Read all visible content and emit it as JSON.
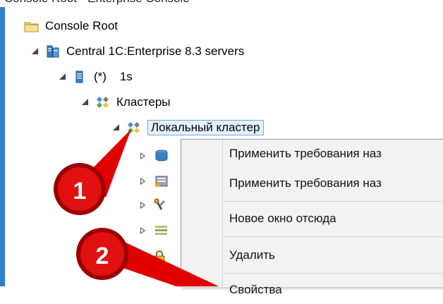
{
  "window": {
    "title": "Console Root - Enterprise Console"
  },
  "tree": {
    "root": {
      "label": "Console Root",
      "icon": "folder-icon"
    },
    "servers": {
      "label": "Central 1C:Enterprise 8.3 servers",
      "icon": "servers-icon"
    },
    "host": {
      "label": "(*)    1s",
      "icon": "server-icon"
    },
    "clusters": {
      "label": "Кластеры",
      "icon": "clusters-icon"
    },
    "local_cluster": {
      "label": "Локальный кластер",
      "icon": "cluster-icon"
    },
    "children_icons": [
      "database-icon",
      "workserver-icon",
      "admins-icon",
      "list-icon",
      "lock-icon"
    ]
  },
  "context_menu": {
    "items": [
      "Применить требования наз",
      "Применить требования наз",
      "Новое окно отсюда",
      "Удалить",
      "Свойства"
    ]
  },
  "annotations": [
    {
      "number": "1"
    },
    {
      "number": "2"
    }
  ],
  "colors": {
    "accent": "#2f7fd0",
    "callout_red": "#e00000",
    "callout_dark": "#9a0000"
  }
}
